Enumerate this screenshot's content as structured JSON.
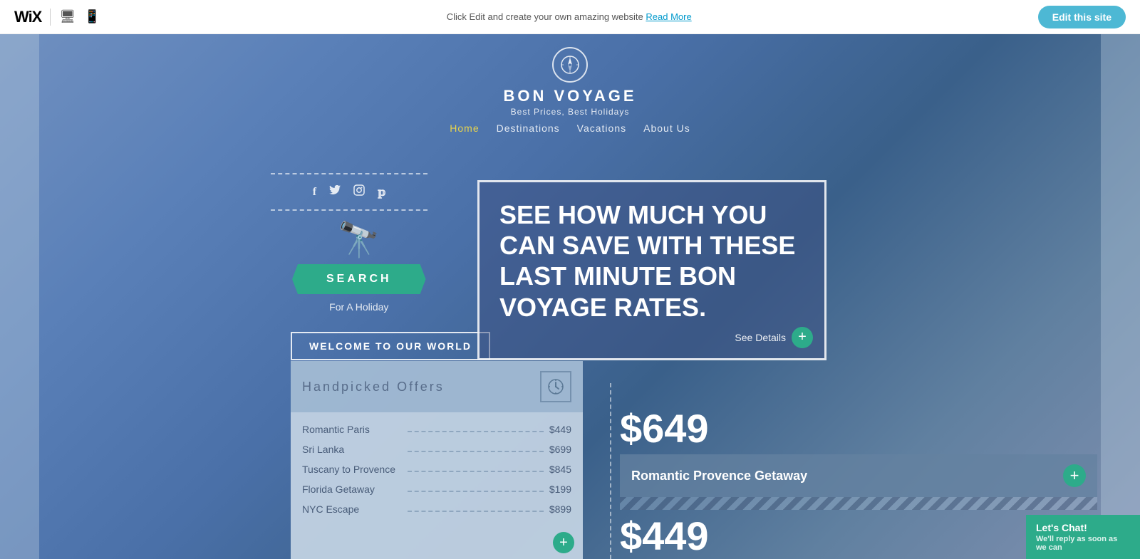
{
  "topbar": {
    "wix_label": "WiX",
    "edit_prompt": "Click Edit and create your own amazing website",
    "read_more": "Read More",
    "edit_btn": "Edit this site"
  },
  "site": {
    "compass_icon": "⊕",
    "title": "BON VOYAGE",
    "subtitle": "Best Prices, Best Holidays",
    "nav": [
      {
        "label": "Home",
        "active": true
      },
      {
        "label": "Destinations",
        "active": false
      },
      {
        "label": "Vacations",
        "active": false
      },
      {
        "label": "About Us",
        "active": false
      }
    ]
  },
  "social": {
    "facebook": "f",
    "twitter": "t",
    "instagram": "⊙",
    "pinterest": "p"
  },
  "search": {
    "binoculars": "🔭",
    "btn_label": "SEARCH",
    "subtitle": "For A Holiday"
  },
  "welcome": {
    "btn_label": "WELCOME TO OUR WORLD"
  },
  "hero": {
    "text": "SEE HOW MUCH YOU CAN SAVE WITH THESE LAST MINUTE BON VOYAGE RATES.",
    "see_details": "See Details"
  },
  "offers": {
    "title": "Handpicked Offers",
    "items": [
      {
        "name": "Romantic Paris",
        "price": "$449"
      },
      {
        "name": "Sri Lanka",
        "price": "$699"
      },
      {
        "name": "Tuscany to Provence",
        "price": "$845"
      },
      {
        "name": "Florida Getaway",
        "price": "$199"
      },
      {
        "name": "NYC Escape",
        "price": "$899"
      }
    ]
  },
  "right_section": {
    "price1": "$649",
    "romantic_provence": "Romantic Provence Getaway",
    "price2": "$449"
  },
  "chat": {
    "label": "Let's Chat!",
    "sub": "We'll reply as soon as we can"
  }
}
